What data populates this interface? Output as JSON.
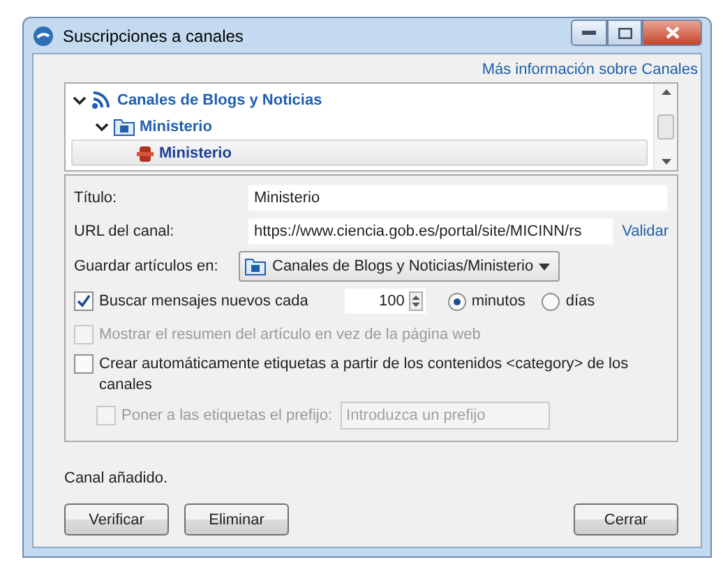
{
  "window": {
    "title": "Suscripciones a canales"
  },
  "info_link": "Más información sobre Canales",
  "tree": [
    {
      "label": "Canales de Blogs y Noticias",
      "kind": "account",
      "expanded": true,
      "selected": false,
      "children": [
        {
          "label": "Ministerio",
          "kind": "folder",
          "expanded": true,
          "selected": false,
          "children": [
            {
              "label": "Ministerio",
              "kind": "feed",
              "selected": true
            }
          ]
        }
      ]
    }
  ],
  "form": {
    "title_label": "Título:",
    "title_value": "Ministerio",
    "url_label": "URL del canal:",
    "url_value": "https://www.ciencia.gob.es/portal/site/MICINN/rs",
    "validate_link": "Validar",
    "save_label": "Guardar artículos en:",
    "save_value": "Canales de Blogs y Noticias/Ministerio",
    "check_new": {
      "label": "Buscar mensajes nuevos cada",
      "checked": true,
      "value": "100"
    },
    "units": [
      {
        "label": "minutos",
        "selected": true
      },
      {
        "label": "días",
        "selected": false
      }
    ],
    "show_summary": {
      "label": "Mostrar el resumen del artículo en vez de la página web",
      "checked": false,
      "disabled": true
    },
    "create_tags": {
      "label": "Crear automáticamente etiquetas a partir de los contenidos <category> de los canales",
      "checked": false,
      "disabled": false
    },
    "prefix": {
      "label": "Poner a las etiquetas el prefijo:",
      "checked": false,
      "disabled": true,
      "placeholder": "Introduzca un prefijo"
    }
  },
  "status": "Canal añadido.",
  "buttons": [
    {
      "label": "Verificar"
    },
    {
      "label": "Eliminar"
    },
    {
      "label": "Cerrar"
    }
  ]
}
